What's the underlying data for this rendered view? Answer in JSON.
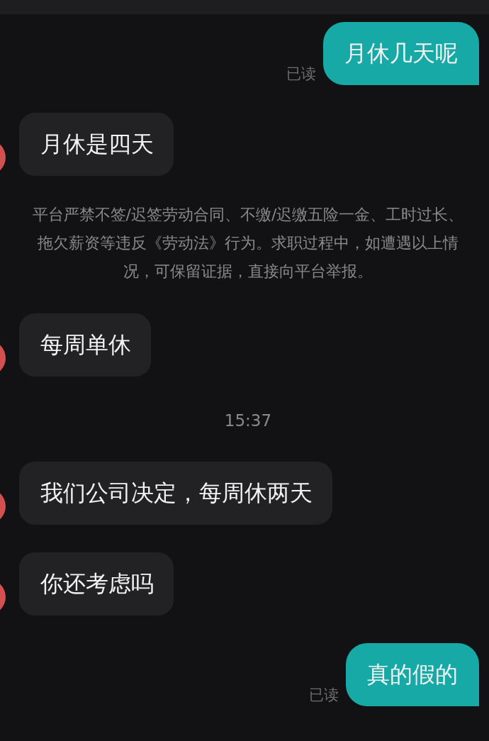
{
  "messages": [
    {
      "kind": "sent",
      "text": "月休几天呢",
      "status": "已读"
    },
    {
      "kind": "received",
      "text": "月休是四天"
    },
    {
      "kind": "notice",
      "text": "平台严禁不签/迟签劳动合同、不缴/迟缴五险一金、工时过长、拖欠薪资等违反《劳动法》行为。求职过程中，如遭遇以上情况，可保留证据，直接向平台举报。"
    },
    {
      "kind": "received",
      "text": "每周单休"
    },
    {
      "kind": "time",
      "text": "15:37"
    },
    {
      "kind": "received",
      "text": "我们公司决定，每周休两天"
    },
    {
      "kind": "received",
      "text": "你还考虑吗"
    },
    {
      "kind": "sent",
      "text": "真的假的",
      "status": "已读"
    }
  ]
}
